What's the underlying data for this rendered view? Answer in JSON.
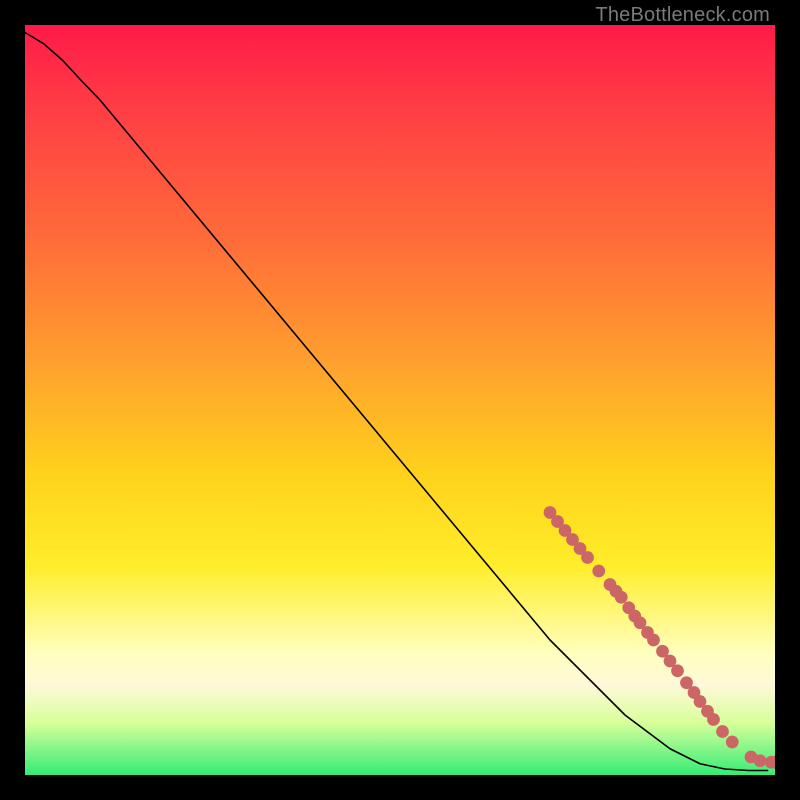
{
  "watermark": "TheBottleneck.com",
  "chart_data": {
    "type": "line",
    "title": "",
    "xlabel": "",
    "ylabel": "",
    "xlim": [
      0,
      100
    ],
    "ylim": [
      0,
      100
    ],
    "grid": false,
    "curve": {
      "name": "curve",
      "type": "line",
      "points": [
        {
          "x": 0.0,
          "y": 99.0
        },
        {
          "x": 2.5,
          "y": 97.5
        },
        {
          "x": 5.0,
          "y": 95.3
        },
        {
          "x": 7.5,
          "y": 92.6
        },
        {
          "x": 10.0,
          "y": 90.0
        },
        {
          "x": 20.0,
          "y": 78.0
        },
        {
          "x": 30.0,
          "y": 66.0
        },
        {
          "x": 40.0,
          "y": 54.0
        },
        {
          "x": 50.0,
          "y": 42.0
        },
        {
          "x": 60.0,
          "y": 30.0
        },
        {
          "x": 70.0,
          "y": 18.0
        },
        {
          "x": 80.0,
          "y": 8.0
        },
        {
          "x": 86.0,
          "y": 3.5
        },
        {
          "x": 90.0,
          "y": 1.5
        },
        {
          "x": 93.3,
          "y": 0.8
        },
        {
          "x": 96.5,
          "y": 0.6
        },
        {
          "x": 99.0,
          "y": 0.6
        }
      ]
    },
    "dots": {
      "name": "markers",
      "type": "scatter",
      "color": "#cc6666",
      "radius_pct": 0.85,
      "points": [
        {
          "x": 70.0,
          "y": 35.0
        },
        {
          "x": 71.0,
          "y": 33.8
        },
        {
          "x": 72.0,
          "y": 32.6
        },
        {
          "x": 73.0,
          "y": 31.4
        },
        {
          "x": 74.0,
          "y": 30.2
        },
        {
          "x": 75.0,
          "y": 29.0
        },
        {
          "x": 76.5,
          "y": 27.2
        },
        {
          "x": 78.0,
          "y": 25.4
        },
        {
          "x": 78.8,
          "y": 24.5
        },
        {
          "x": 79.5,
          "y": 23.7
        },
        {
          "x": 80.5,
          "y": 22.3
        },
        {
          "x": 81.3,
          "y": 21.2
        },
        {
          "x": 82.0,
          "y": 20.3
        },
        {
          "x": 83.0,
          "y": 19.0
        },
        {
          "x": 83.8,
          "y": 18.0
        },
        {
          "x": 85.0,
          "y": 16.5
        },
        {
          "x": 86.0,
          "y": 15.2
        },
        {
          "x": 87.0,
          "y": 13.9
        },
        {
          "x": 88.2,
          "y": 12.3
        },
        {
          "x": 89.2,
          "y": 11.0
        },
        {
          "x": 90.0,
          "y": 9.8
        },
        {
          "x": 91.0,
          "y": 8.5
        },
        {
          "x": 91.8,
          "y": 7.4
        },
        {
          "x": 93.0,
          "y": 5.8
        },
        {
          "x": 94.3,
          "y": 4.4
        },
        {
          "x": 96.8,
          "y": 2.4
        },
        {
          "x": 98.0,
          "y": 1.9
        },
        {
          "x": 99.5,
          "y": 1.7
        },
        {
          "x": 100.0,
          "y": 1.7
        }
      ]
    }
  }
}
